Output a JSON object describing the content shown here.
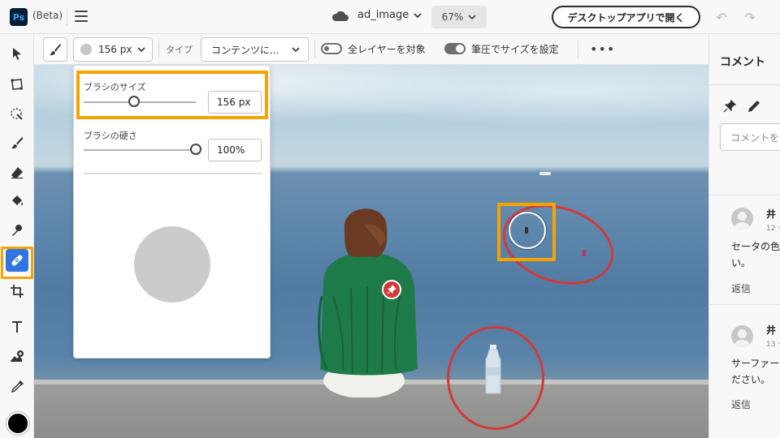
{
  "app": {
    "logo": "Ps",
    "beta_label": "(Beta)",
    "filename": "ad_image",
    "zoom": "67%",
    "open_desktop_label": "デスクトップアプリで開く"
  },
  "options": {
    "brush_size": "156 px",
    "type_label": "タイプ",
    "type_value": "コンテンツに...",
    "all_layers_label": "全レイヤーを対象",
    "all_layers_on": false,
    "pressure_label": "筆圧でサイズを設定",
    "pressure_on": true
  },
  "popover": {
    "size_label": "ブラシのサイズ",
    "size_value": "156 px",
    "size_slider": 0.45,
    "hardness_label": "ブラシの硬さ",
    "hardness_value": "100%",
    "hardness_slider": 1.0
  },
  "tools": [
    {
      "name": "move-icon"
    },
    {
      "name": "transform-icon"
    },
    {
      "name": "quick-select-icon"
    },
    {
      "name": "brush-icon"
    },
    {
      "name": "eraser-icon"
    },
    {
      "name": "paint-bucket-icon"
    },
    {
      "name": "clone-stamp-icon"
    },
    {
      "name": "spot-healing-icon",
      "active": true
    },
    {
      "name": "crop-icon"
    },
    {
      "name": "text-icon"
    },
    {
      "name": "add-image-icon"
    },
    {
      "name": "eyedropper-icon"
    }
  ],
  "foreground_color": "#000000",
  "comments": {
    "title": "コメント",
    "input_placeholder": "コメントを",
    "items": [
      {
        "author": "井",
        "time": "12 ク",
        "text": "セータの色\nい。",
        "reply": "返信"
      },
      {
        "author": "井",
        "time": "13 ク",
        "text": "サーファー\nださい。",
        "reply": "返信"
      }
    ]
  },
  "colors": {
    "accent": "#2f76e0",
    "highlight": "#f5a300",
    "annotation": "#d03a3a"
  }
}
